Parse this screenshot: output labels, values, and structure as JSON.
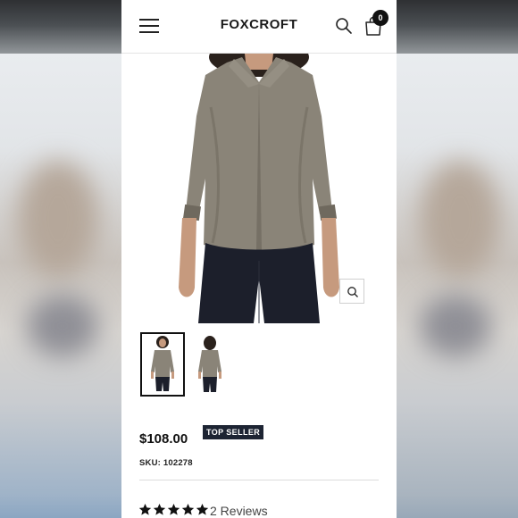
{
  "header": {
    "brand": "FOXCROFT",
    "cart_count": "0"
  },
  "product": {
    "price": "$108.00",
    "badge": "TOP SELLER",
    "sku_label": "SKU:",
    "sku_value": "102278",
    "rating": 5,
    "reviews_label": "2 Reviews",
    "thumbnails": [
      "front-view",
      "back-view"
    ]
  },
  "colors": {
    "shirt": "#8a8478",
    "pants": "#1c1f2b",
    "badge_bg": "#1d2433",
    "text": "#111111"
  },
  "icons": [
    "hamburger-menu-icon",
    "search-icon",
    "shopping-bag-icon",
    "zoom-icon",
    "star-icon"
  ]
}
